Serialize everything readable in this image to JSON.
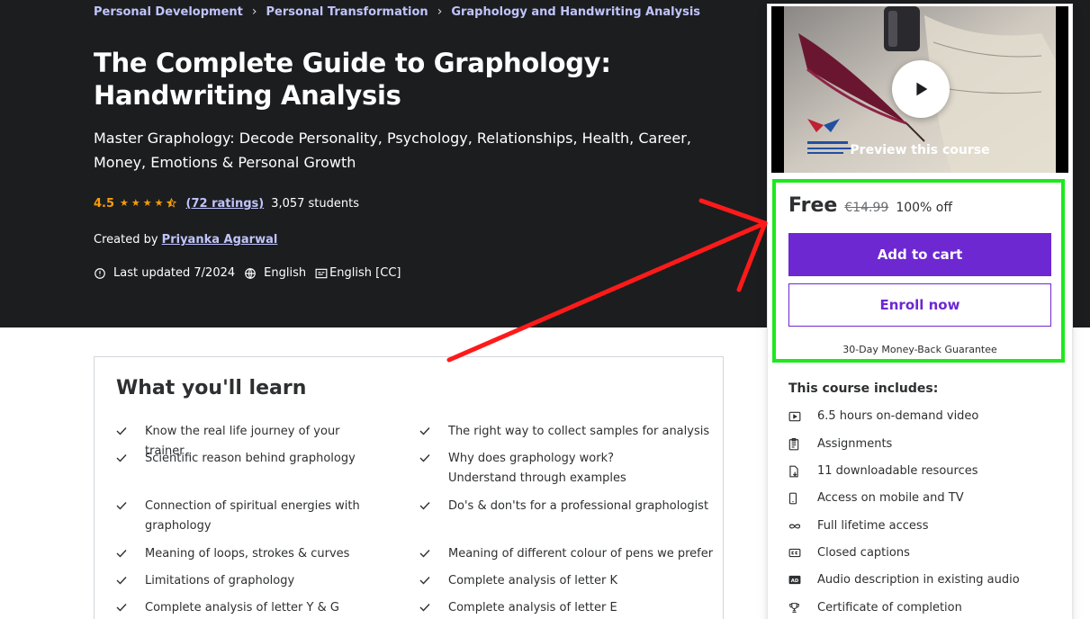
{
  "breadcrumb": {
    "items": [
      "Personal Development",
      "Personal Transformation",
      "Graphology and Handwriting Analysis"
    ],
    "separator": "›"
  },
  "course": {
    "title_line1": "The Complete Guide to Graphology:",
    "title_line2": "Handwriting Analysis",
    "subtitle": "Master Graphology: Decode Personality, Psychology, Relationships, Health, Career, Money, Emotions & Personal Growth",
    "rating": "4.5",
    "ratings_count": "(72 ratings)",
    "students": "3,057 students",
    "created_by_label": "Created by",
    "author": "Priyanka Agarwal",
    "last_updated": "Last updated 7/2024",
    "language": "English",
    "captions": "English [CC]"
  },
  "learn": {
    "title": "What you'll learn",
    "left": [
      "Know the real life journey of your trainer",
      "Scientific reason behind graphology",
      "Connection of spiritual energies with graphology",
      "Meaning of loops, strokes & curves",
      "Limitations of graphology",
      "Complete analysis of letter Y & G"
    ],
    "right": [
      "The right way to collect samples for analysis",
      "Why does graphology work? Understand through examples",
      "Do's & don'ts for a professional graphologist",
      "Meaning of different colour of pens we prefer",
      "Complete analysis of letter K",
      "Complete analysis of letter E"
    ]
  },
  "card": {
    "preview_label": "Preview this course",
    "price_now": "Free",
    "price_old": "€14.99",
    "discount": "100% off",
    "add_to_cart": "Add to cart",
    "enroll_now": "Enroll now",
    "guarantee": "30-Day Money-Back Guarantee",
    "includes_title": "This course includes:",
    "includes": [
      {
        "icon": "video-icon",
        "text": "6.5 hours on-demand video"
      },
      {
        "icon": "assignment-icon",
        "text": "Assignments"
      },
      {
        "icon": "download-file-icon",
        "text": "11 downloadable resources"
      },
      {
        "icon": "mobile-icon",
        "text": "Access on mobile and TV"
      },
      {
        "icon": "infinity-icon",
        "text": "Full lifetime access"
      },
      {
        "icon": "closed-captions-icon",
        "text": "Closed captions"
      },
      {
        "icon": "audio-description-icon",
        "text": "Audio description in existing audio"
      },
      {
        "icon": "trophy-icon",
        "text": "Certificate of completion"
      }
    ]
  },
  "colors": {
    "hero_bg": "#1c1d1f",
    "link": "#c0c4fc",
    "star": "#f69c08",
    "primary": "#6d28d2",
    "highlight_box": "#1ee81e",
    "annotation_arrow": "#ff1a1a"
  }
}
